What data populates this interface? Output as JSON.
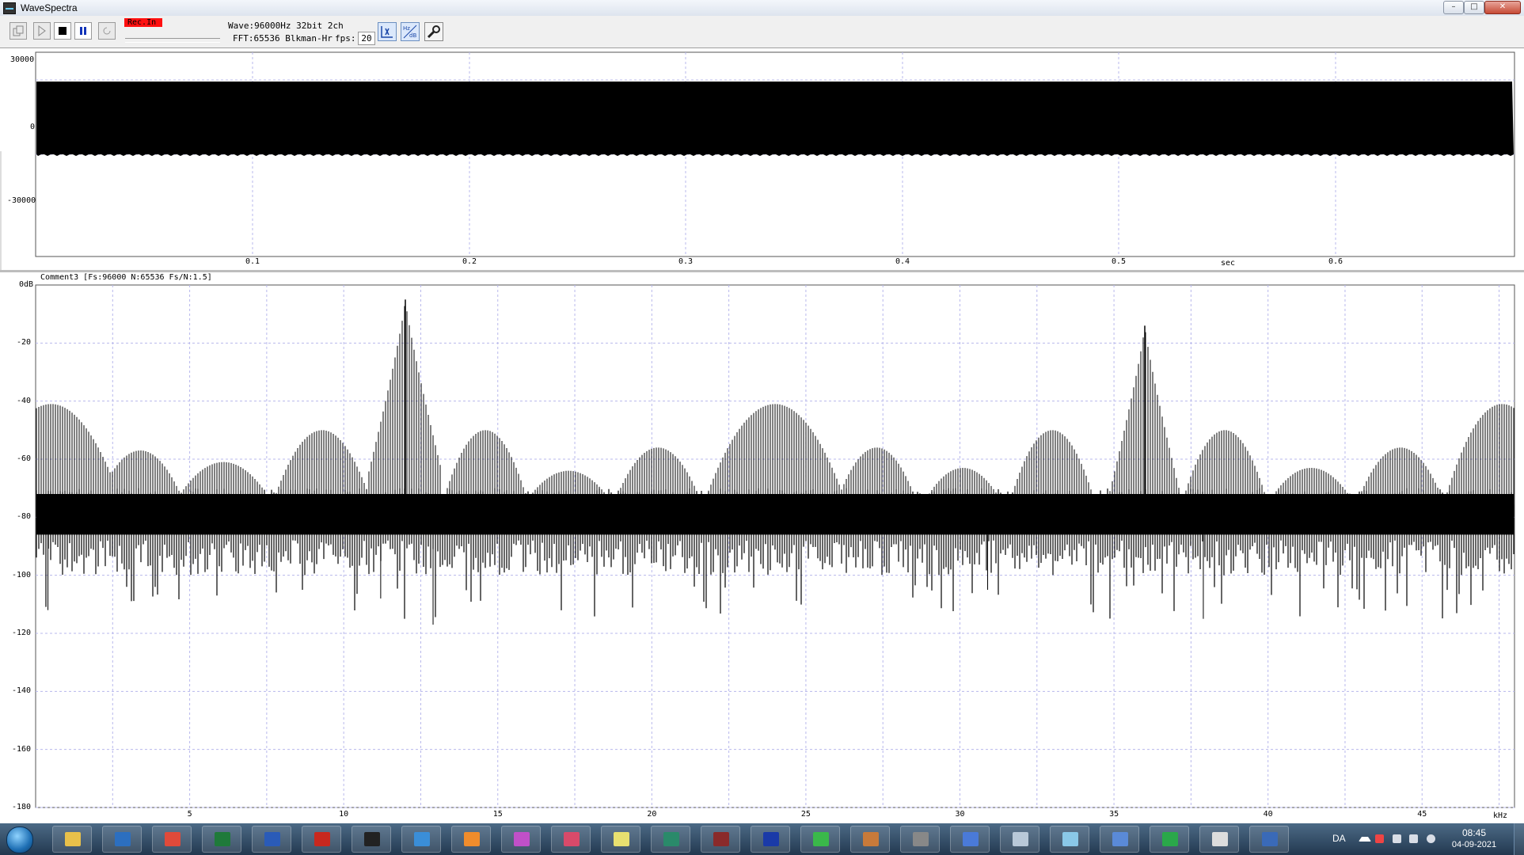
{
  "window": {
    "title": "WaveSpectra",
    "controls": {
      "minimize": "–",
      "maximize": "□",
      "close": "✕"
    }
  },
  "toolbar": {
    "rec_label": "Rec.In",
    "wave_info": "Wave:96000Hz 32bit 2ch",
    "fft_info": "FFT:65536 Blkman-Hr",
    "fps_label": "fps:",
    "fps_value": "20",
    "buttons": [
      {
        "name": "copy-button",
        "icon": "copy-icon"
      },
      {
        "name": "play-button",
        "icon": "play-icon"
      },
      {
        "name": "stop-button",
        "icon": "stop-icon"
      },
      {
        "name": "pause-button",
        "icon": "pause-icon"
      },
      {
        "name": "loop-button",
        "icon": "loop-icon"
      }
    ],
    "right_buttons": [
      {
        "name": "wave-view-button",
        "icon": "wave-view-icon"
      },
      {
        "name": "spectrum-settings-button",
        "icon": "hz-db-icon"
      },
      {
        "name": "settings-button",
        "icon": "wrench-icon"
      }
    ]
  },
  "waveform": {
    "y_ticks": [
      "30000",
      "0",
      "-30000"
    ],
    "x_ticks": [
      "0.1",
      "0.2",
      "0.3",
      "0.4",
      "0.5",
      "0.6"
    ],
    "x_unit": "sec",
    "amplitude_range": [
      0,
      30000
    ]
  },
  "spectrum": {
    "header": "Comment3  [Fs:96000 N:65536 Fs/N:1.5]",
    "y_ticks": [
      "0dB",
      "-20",
      "-40",
      "-60",
      "-80",
      "-100",
      "-120",
      "-140",
      "-160",
      "-180"
    ],
    "x_ticks": [
      "5",
      "10",
      "15",
      "20",
      "25",
      "30",
      "35",
      "40",
      "45"
    ],
    "x_unit": "kHz",
    "x_range_khz": [
      0,
      48
    ],
    "y_range_db": [
      -180,
      0
    ],
    "peaks_khz_db": [
      [
        12,
        -5
      ],
      [
        36,
        -14
      ]
    ],
    "noise_floor_db": -80
  },
  "taskbar": {
    "language": "DA",
    "time": "08:45",
    "date": "04-09-2021",
    "apps": [
      "explorer-icon",
      "outlook-icon",
      "chrome-icon",
      "excel-icon",
      "word-icon",
      "acrobat-icon",
      "ccleaner-icon",
      "feather-icon",
      "gallery-icon",
      "photos-icon",
      "paint-icon",
      "bulb-icon",
      "graph-icon",
      "audio-editor-icon",
      "video-player-icon",
      "palette-icon",
      "circuit-icon",
      "spring-icon",
      "editor-icon",
      "calculator-icon",
      "eraser-icon",
      "network-icon",
      "signal-icon",
      "wavespectra-icon",
      "print-icon"
    ]
  }
}
